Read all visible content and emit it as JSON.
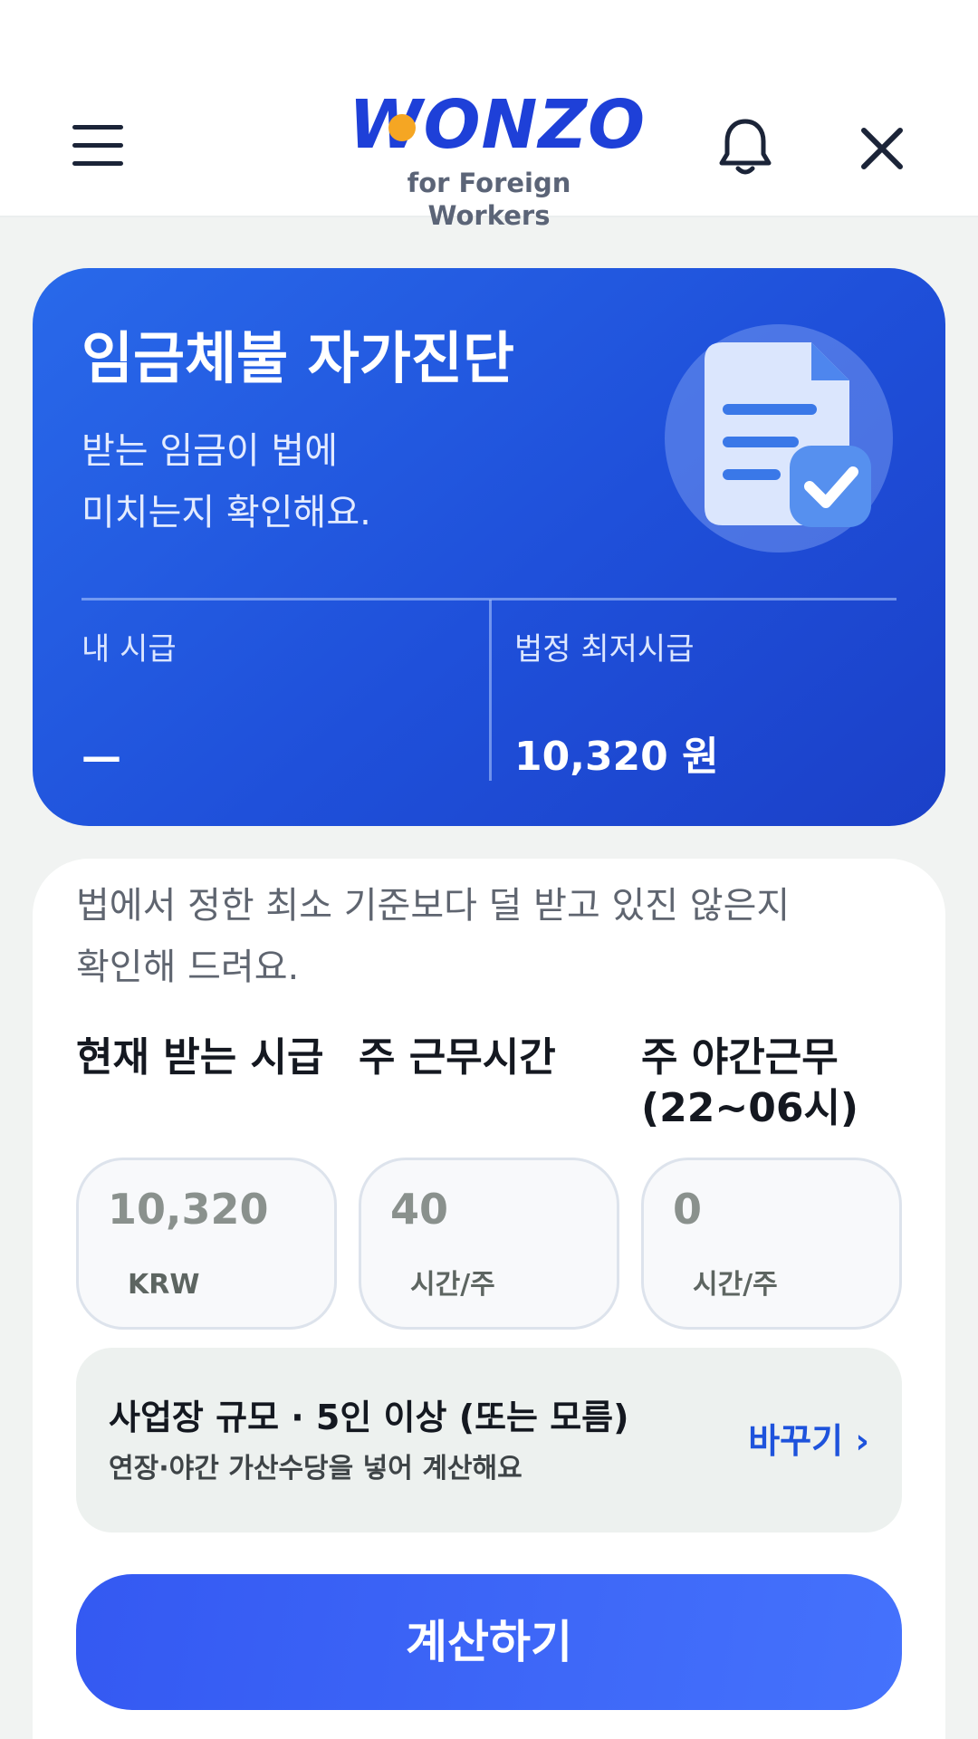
{
  "header": {
    "logo_text": "WONZO",
    "logo_subtitle": "for Foreign Workers",
    "icons": {
      "menu": "hamburger-menu-icon",
      "bell": "bell-icon",
      "close": "close-icon"
    }
  },
  "hero": {
    "title": "임금체불 자가진단",
    "description_line1": "받는 임금이 법에",
    "description_line2": "미치는지 확인해요.",
    "my_wage_label": "내 시급",
    "my_wage_value": "—",
    "min_wage_label": "법정 최저시급",
    "min_wage_value": "10,320 원",
    "illustration": "document-check-icon"
  },
  "form": {
    "intro_line1": "법에서 정한 최소 기준보다 덜 받고 있진 않은지",
    "intro_line2": "확인해 드려요.",
    "fields": [
      {
        "label_line1": "현재 받는 시급",
        "label_line2": "",
        "value": "10,320",
        "unit": "KRW"
      },
      {
        "label_line1": "주 근무시간",
        "label_line2": "",
        "value": "40",
        "unit": "시간/주"
      },
      {
        "label_line1": "주 야간근무",
        "label_line2": "(22~06시)",
        "value": "0",
        "unit": "시간/주"
      }
    ],
    "business": {
      "title": "사업장 규모 · 5인 이상 (또는 모름)",
      "subtitle": "연장·야간 가산수당을 넣어 계산해요",
      "change_label": "바꾸기 ›"
    },
    "submit_label": "계산하기"
  },
  "colors": {
    "primary": "#1f50da",
    "accent": "#f5a623",
    "button": "#3d66f8"
  }
}
